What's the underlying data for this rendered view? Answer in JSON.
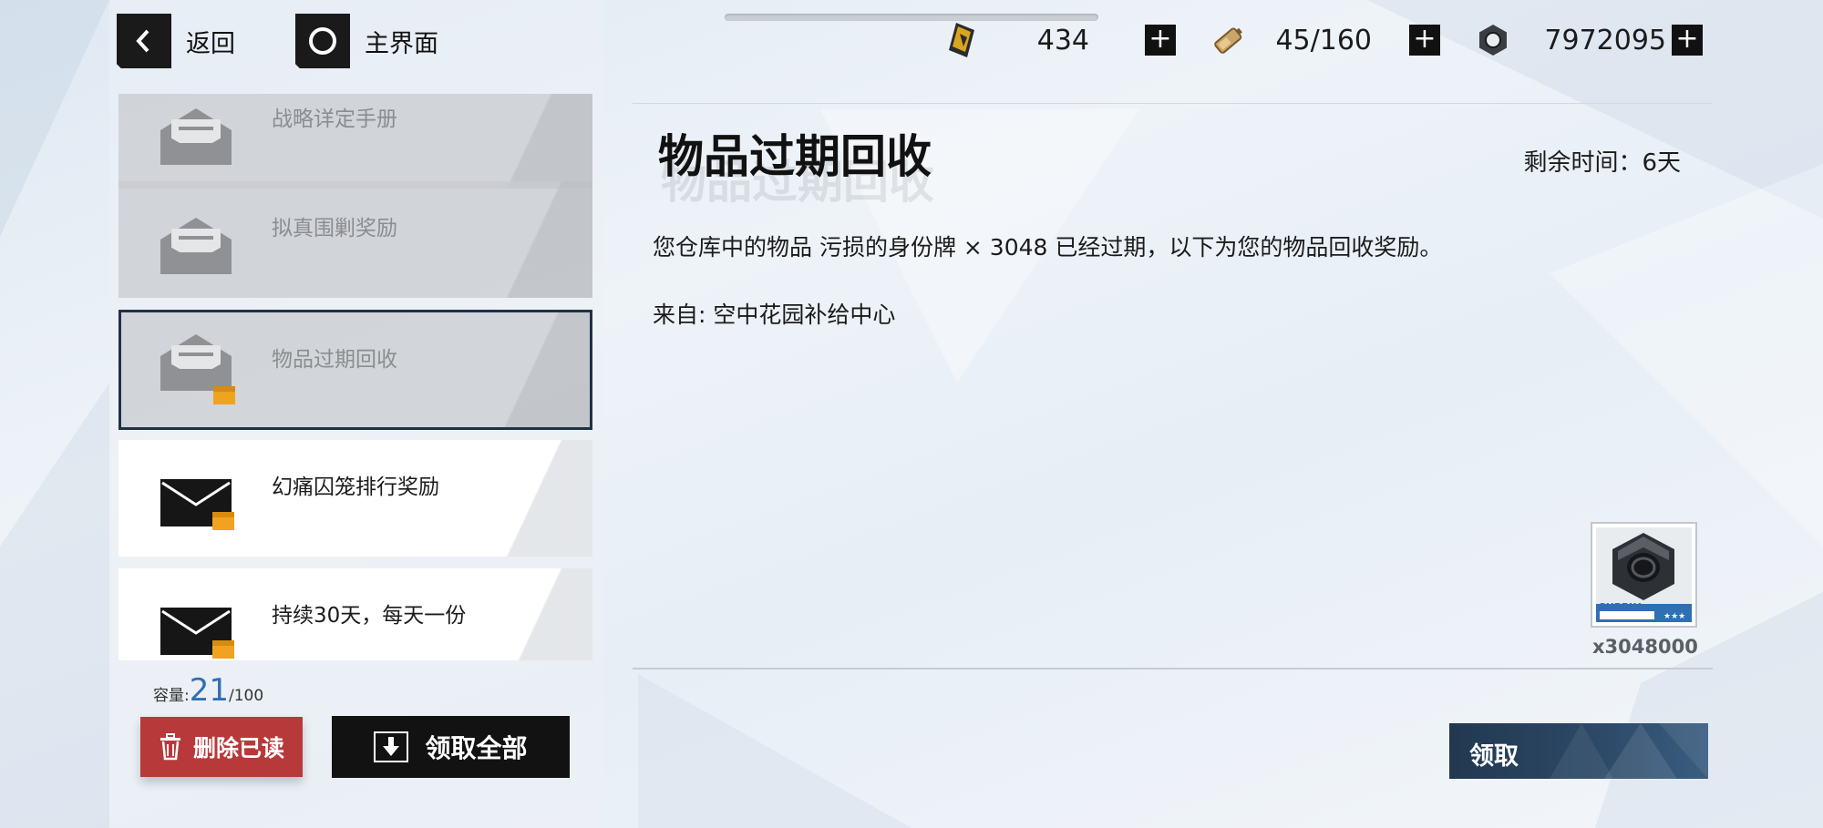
{
  "colors": {
    "accent": "#2f6fb3",
    "delete": "#b8393a",
    "claim": "#223850",
    "dark": "#121212"
  },
  "nav": {
    "back_icon": "chevron-left-icon",
    "back_label": "返回",
    "home_icon": "circle-icon",
    "home_label": "主界面"
  },
  "resources": [
    {
      "icon": "card-ticket-icon",
      "value": "434"
    },
    {
      "icon": "battery-icon",
      "value": "45/160"
    },
    {
      "icon": "hex-nut-icon",
      "value": "7972095"
    }
  ],
  "mails": [
    {
      "title": "战略详定手册",
      "state": "read",
      "has_attachment": false
    },
    {
      "title": "拟真围剿奖励",
      "state": "read",
      "has_attachment": false
    },
    {
      "title": "物品过期回收",
      "state": "read-selected",
      "has_attachment": true
    },
    {
      "title": "幻痛囚笼排行奖励",
      "state": "unread",
      "has_attachment": true
    },
    {
      "title": "持续30天，每天一份",
      "state": "unread",
      "has_attachment": true
    }
  ],
  "capacity": {
    "label": "容量:",
    "current": "21",
    "max": "/100"
  },
  "actions": {
    "delete_read": "删除已读",
    "claim_all": "领取全部"
  },
  "detail": {
    "title": "物品过期回收",
    "remaining": "剩余时间：6天",
    "body": "您仓库中的物品 污损的身份牌 × 3048 已经过期，以下为您的物品回收奖励。",
    "from": "来自: 空中花园补给中心",
    "reward": {
      "icon": "hex-nut-icon",
      "tag": "SUPPLY",
      "rarity": "★★★",
      "quantity": "x3048000"
    },
    "claim_label": "领取"
  }
}
